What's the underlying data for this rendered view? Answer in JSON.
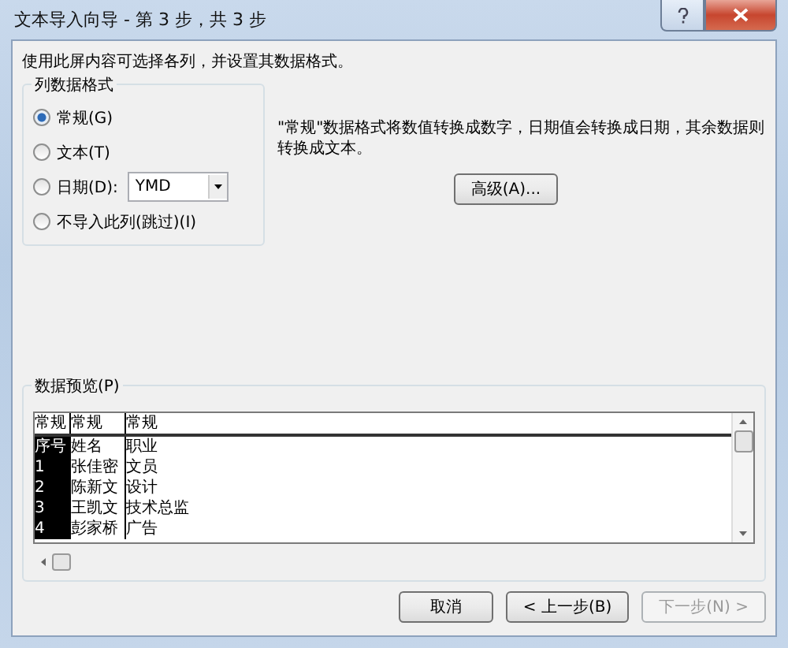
{
  "window": {
    "title": "文本导入向导 - 第 3 步，共 3 步"
  },
  "instruction": "使用此屏内容可选择各列，并设置其数据格式。",
  "column_format": {
    "title": "列数据格式",
    "options": [
      {
        "kind": "radio",
        "label": "常规(G)",
        "selected": true
      },
      {
        "kind": "radio",
        "label": "文本(T)",
        "selected": false
      },
      {
        "kind": "date",
        "label": "日期(D):",
        "selected": false,
        "value": "YMD"
      },
      {
        "kind": "radio",
        "label": "不导入此列(跳过)(I)",
        "selected": false
      }
    ]
  },
  "description": "\"常规\"数据格式将数值转换成数字，日期值会转换成日期，其余数据则转换成文本。",
  "advanced_button": "高级(A)...",
  "preview": {
    "title": "数据预览(P)",
    "columns": [
      {
        "header": "常规",
        "selected": true
      },
      {
        "header": "常规",
        "selected": false
      },
      {
        "header": "常规",
        "selected": false
      }
    ],
    "rows": [
      [
        "序号",
        "姓名",
        "职业"
      ],
      [
        "1",
        "张佳密",
        "文员"
      ],
      [
        "2",
        "陈新文",
        "设计"
      ],
      [
        "3",
        "王凯文",
        "技术总监"
      ],
      [
        "4",
        "彭家桥",
        "广告"
      ]
    ]
  },
  "buttons": [
    {
      "label": "取消",
      "disabled": false
    },
    {
      "label": "< 上一步(B)",
      "disabled": false
    },
    {
      "label": "下一步(N) >",
      "disabled": true
    }
  ]
}
